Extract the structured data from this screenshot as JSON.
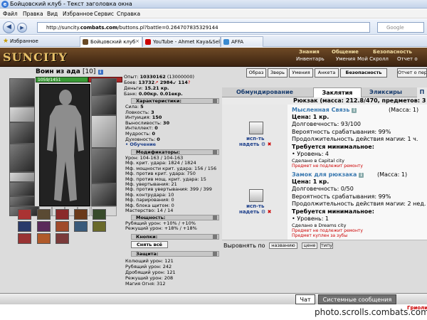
{
  "window": {
    "title": "Бойцовский клуб - Текст заголовка окна",
    "icon": "ie-icon"
  },
  "menu": [
    "Файл",
    "Правка",
    "Вид",
    "Избранное",
    "Сервис",
    "Справка"
  ],
  "address": {
    "prefix": "http://suncity.",
    "domain": "combats.com",
    "suffix": "/buttons.pl?battle=0.264707835329144",
    "search_placeholder": "Google"
  },
  "favorites_label": "Избранное",
  "browser_tabs": [
    {
      "label": "Бойцовский клуб",
      "active": true
    },
    {
      "label": "YouTube - Ahmet Kaya&Seld...",
      "active": false
    },
    {
      "label": "AFFA",
      "active": false
    }
  ],
  "site": {
    "logo": "SUNCITY",
    "topnav": [
      "Знания",
      "Общение",
      "Безопасность"
    ],
    "subnav": [
      "Инвентарь",
      "Умения",
      "Мой Скролл",
      "Отчет о"
    ]
  },
  "character": {
    "name": "Воин из ада",
    "level": "[10]",
    "hp": "1059/1451",
    "stats": {
      "exp_label": "Опыт:",
      "exp": "10330162",
      "exp_next": "(13000000)",
      "battles_label": "Боев:",
      "wins": "13732",
      "losses": "2984",
      "draws": "114",
      "money_label": "Деньги:",
      "money": "15.21 кр.",
      "bank_label": "Банк:",
      "bank": "0.00кр. 0.01екр."
    },
    "characteristics_title": "Характеристики:",
    "characteristics": [
      [
        "Сила:",
        "5"
      ],
      [
        "Ловкость:",
        "3"
      ],
      [
        "Интуиция:",
        "150"
      ],
      [
        "Выносливость:",
        "30"
      ],
      [
        "Интеллект:",
        "0"
      ],
      [
        "Мудрость:",
        "0"
      ],
      [
        "Духовность:",
        "0"
      ]
    ],
    "training": "• Обучение",
    "modifiers_title": "Модификаторы:",
    "modifiers": [
      "Урон: 104-163 / 104-163",
      "Мф. крит. удара: 1824 / 1824",
      "Мф. мощности крит. удара: 156 / 156",
      "Мф. против крит. удара: 750",
      "Мф. против мощ. крит. удара: 15",
      "Мф. увертывания: 21",
      "Мф. против увертывания: 399 / 399",
      "Мф. контрудара: 10",
      "Мф. парирования: 0",
      "Мф. блока щитом: 0",
      "Мастерство: 14 / 14"
    ],
    "power_title": "Мощность:",
    "power": [
      "Рубящий урон: +10% / +10%",
      "Режущий урон: +18% / +18%"
    ],
    "buttons_title": "Кнопки:",
    "action_button": "Снять всё",
    "protection_title": "Защита:",
    "protection": [
      "Колющий урон: 121",
      "Рубящий урон: 242",
      "Дробящий урон: 121",
      "Режущий урон: 208",
      "Магия Огня: 312"
    ]
  },
  "right_buttons": [
    "Образ",
    "Зверь",
    "Умения",
    "Анкета",
    "Безопасность",
    "Отчет о пер"
  ],
  "inventory_tabs": [
    {
      "label": "Обмундирование",
      "active": false
    },
    {
      "label": "Заклятия",
      "active": true
    },
    {
      "label": "Эликсиры",
      "active": false
    },
    {
      "label": "П",
      "active": false
    }
  ],
  "backpack": "Рюкзак (масса: 212.8/470, предметов: 3",
  "items": [
    {
      "name": "Мысленная Связь",
      "mass": "(Масса: 1)",
      "use_label": "исп-ть",
      "wear_label": "надеть",
      "price": "Цена: 1 кр.",
      "durability": "Долговечность: 93/100",
      "chance": "Вероятность срабатывания: 99%",
      "duration": "Продолжительность действия магии: 1 ч.",
      "req_title": "Требуется минимальное:",
      "req": "• Уровень: 4",
      "made": "Сделано в Capital city",
      "warn": "Предмет не подлежит ремонту"
    },
    {
      "name": "Замок для рюкзака",
      "mass": "(Масса: 1)",
      "use_label": "исп-ть",
      "wear_label": "надеть",
      "price": "Цена: 1 кр.",
      "durability": "Долговечность: 0/50",
      "chance": "Вероятность срабатывания: 99%",
      "duration": "Продолжительность действия магии: 2 нед.",
      "req_title": "Требуется минимальное:",
      "req": "• Уровень: 1",
      "made": "Сделано в Dreams city",
      "warn": "Предмет не подлежит ремонту",
      "warn2": "Предмет куплен за зубы"
    }
  ],
  "sort": {
    "label": "Выровнять по",
    "buttons": [
      "названию",
      "цене",
      "типу"
    ]
  },
  "chat_tabs": [
    {
      "label": "Чат",
      "active": true
    },
    {
      "label": "Системные сообщения",
      "active": false
    }
  ],
  "watermark": "photo.scrolls.combats.com",
  "corner_text": "Гриоли"
}
